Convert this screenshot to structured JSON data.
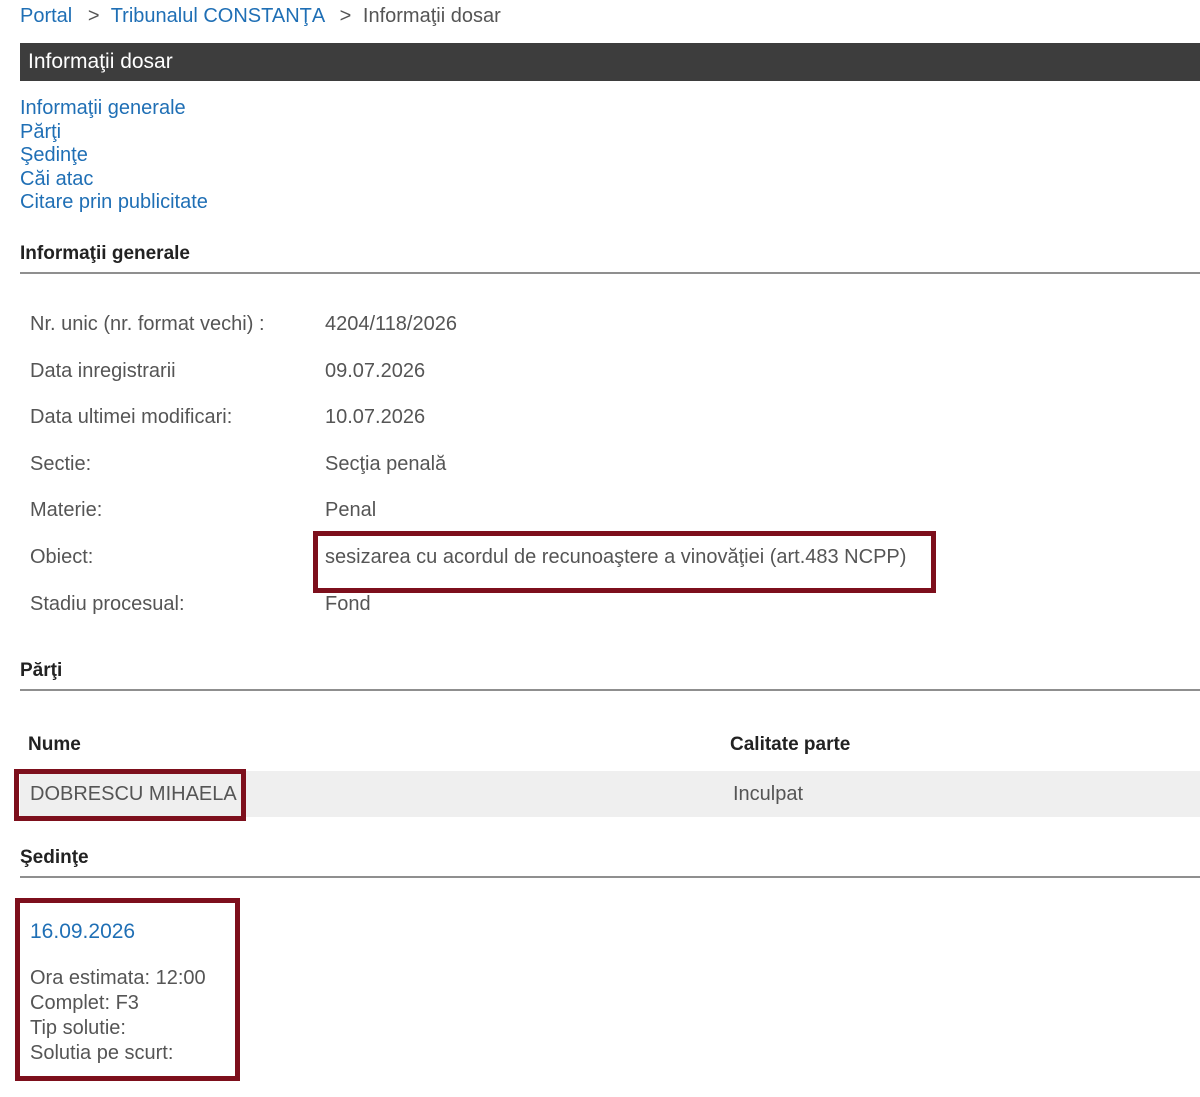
{
  "breadcrumb": {
    "portal": "Portal",
    "separator": ">",
    "court": "Tribunalul CONSTANŢA",
    "current": "Informaţii dosar"
  },
  "title": "Informaţii dosar",
  "nav": {
    "informatii_generale": "Informaţii generale",
    "parti": "Părţi",
    "sedinte": "Şedinţe",
    "cai_atac": "Căi atac",
    "citare": "Citare prin publicitate"
  },
  "general": {
    "heading": "Informaţii generale",
    "rows": [
      {
        "label": "Nr. unic (nr. format vechi) :",
        "value": "4204/118/2026"
      },
      {
        "label": "Data inregistrarii",
        "value": "09.07.2026"
      },
      {
        "label": "Data ultimei modificari:",
        "value": "10.07.2026"
      },
      {
        "label": "Sectie:",
        "value": "Secţia penală"
      },
      {
        "label": "Materie:",
        "value": "Penal"
      },
      {
        "label": "Obiect:",
        "value": "sesizarea cu acordul de recunoaştere a vinovăţiei (art.483 NCPP)"
      },
      {
        "label": "Stadiu procesual:",
        "value": "Fond"
      }
    ]
  },
  "parti": {
    "heading": "Părţi",
    "col_nume": "Nume",
    "col_calitate": "Calitate parte",
    "rows": [
      {
        "nume": "DOBRESCU MIHAELA",
        "calitate": "Inculpat"
      }
    ]
  },
  "sedinte": {
    "heading": "Şedinţe",
    "date": "16.09.2026",
    "ora": "Ora estimata: 12:00",
    "complet": "Complet: F3",
    "tip_solutie": "Tip solutie:",
    "solutia": "Solutia pe scurt:"
  },
  "colors": {
    "link": "#1f6fb5",
    "titlebar": "#3d3d3d",
    "highlight": "#7d0f1c"
  }
}
